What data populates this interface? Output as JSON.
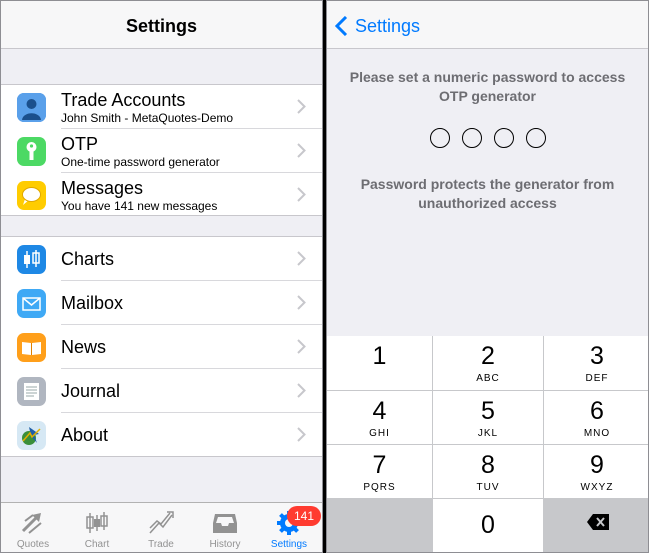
{
  "left": {
    "title": "Settings",
    "group1": [
      {
        "title": "Trade Accounts",
        "subtitle": "John  Smith - MetaQuotes-Demo",
        "icon": "user-icon",
        "color": "#4a90e2"
      },
      {
        "title": "OTP",
        "subtitle": "One-time password generator",
        "icon": "key-icon",
        "color": "#4cd964"
      },
      {
        "title": "Messages",
        "subtitle": "You have 141 new messages",
        "icon": "speech-bubble-icon",
        "color": "#ffcc00"
      }
    ],
    "group2": [
      {
        "title": "Charts",
        "icon": "candlestick-icon",
        "color": "#1e88e5"
      },
      {
        "title": "Mailbox",
        "icon": "envelope-icon",
        "color": "#3fa9f5"
      },
      {
        "title": "News",
        "icon": "book-icon",
        "color": "#ff9f1a"
      },
      {
        "title": "Journal",
        "icon": "document-lines-icon",
        "color": "#b0b6c0"
      },
      {
        "title": "About",
        "icon": "metatrader-logo-icon",
        "color": "#cfe3f0"
      }
    ],
    "tabs": [
      {
        "label": "Quotes",
        "icon": "quotes-arrows-icon",
        "active": false
      },
      {
        "label": "Chart",
        "icon": "candlestick-icon",
        "active": false
      },
      {
        "label": "Trade",
        "icon": "trend-line-icon",
        "active": false
      },
      {
        "label": "History",
        "icon": "inbox-tray-icon",
        "active": false
      },
      {
        "label": "Settings",
        "icon": "gear-icon",
        "active": true
      }
    ],
    "badge": "141"
  },
  "right": {
    "back_label": "Settings",
    "prompt": "Please set a numeric password to access OTP generator",
    "note": "Password protects the generator from unauthorized access",
    "keys": [
      {
        "num": "1",
        "letters": ""
      },
      {
        "num": "2",
        "letters": "ABC"
      },
      {
        "num": "3",
        "letters": "DEF"
      },
      {
        "num": "4",
        "letters": "GHI"
      },
      {
        "num": "5",
        "letters": "JKL"
      },
      {
        "num": "6",
        "letters": "MNO"
      },
      {
        "num": "7",
        "letters": "PQRS"
      },
      {
        "num": "8",
        "letters": "TUV"
      },
      {
        "num": "9",
        "letters": "WXYZ"
      },
      {
        "num": "0",
        "letters": ""
      }
    ]
  },
  "colors": {
    "accent": "#007aff",
    "badge": "#ff3b30"
  }
}
